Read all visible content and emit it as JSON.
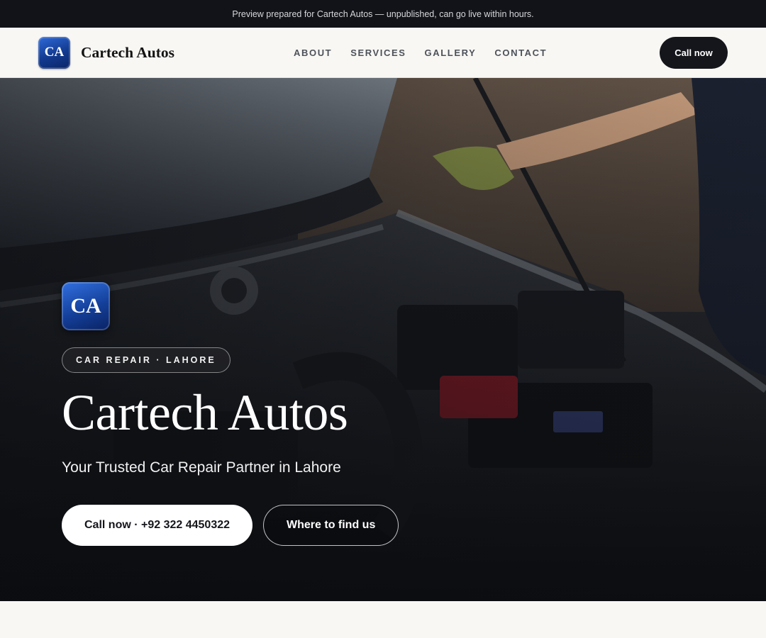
{
  "banner": {
    "text": "Preview prepared for Cartech Autos — unpublished, can go live within hours."
  },
  "nav": {
    "logo_initials": "CA",
    "brand_name": "Cartech Autos",
    "links": [
      "ABOUT",
      "SERVICES",
      "GALLERY",
      "CONTACT"
    ],
    "cta_label": "Call now"
  },
  "hero": {
    "logo_initials": "CA",
    "tagline": "CAR REPAIR · LAHORE",
    "title": "Cartech Autos",
    "subtitle": "Your Trusted Car Repair Partner in Lahore",
    "primary_button": "Call now · +92 322 4450322",
    "secondary_button": "Where to find us"
  },
  "colors": {
    "banner_bg": "#111318",
    "brand_blue": "#14409a",
    "cta_dark": "#15161b",
    "page_bg": "#f8f7f4"
  }
}
